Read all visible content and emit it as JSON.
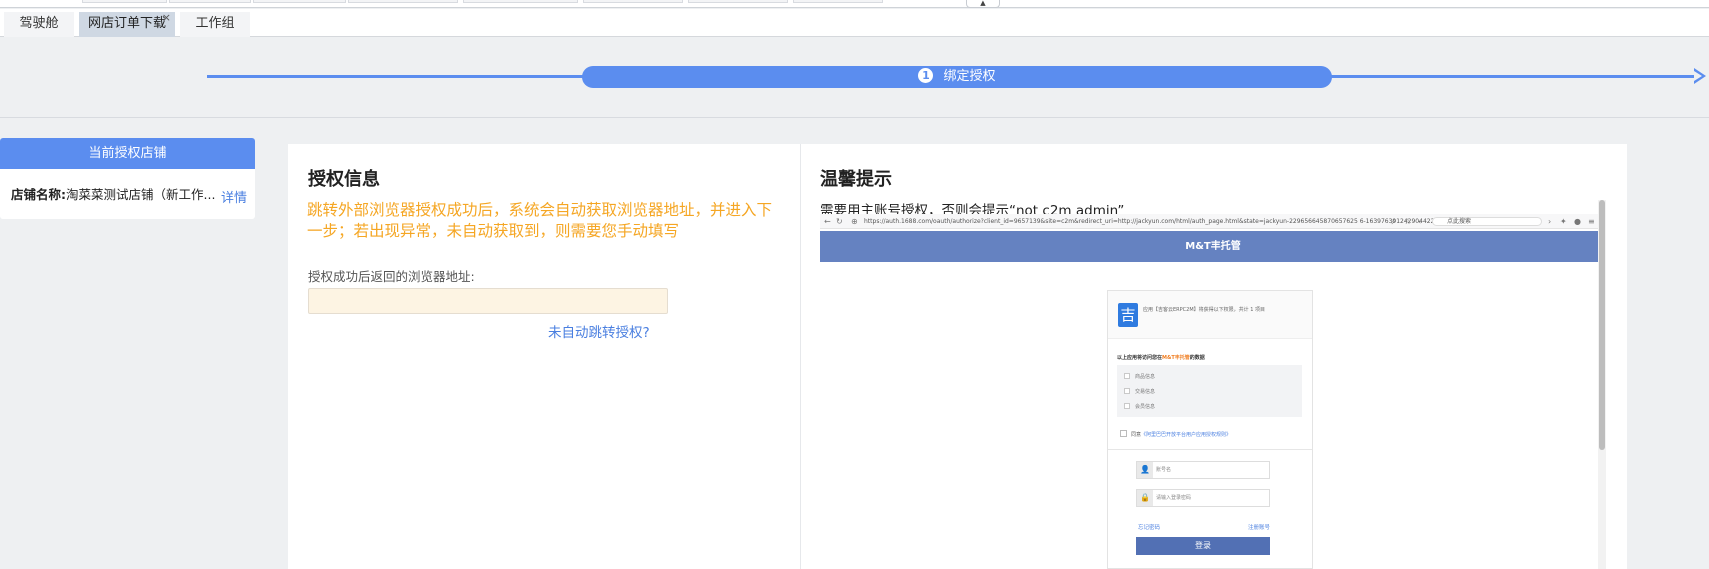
{
  "tabs": [
    {
      "label": "驾驶舱",
      "active": false
    },
    {
      "label": "网店订单下载",
      "active": true,
      "close": "×"
    },
    {
      "label": "工作组",
      "active": false
    }
  ],
  "collapse_glyph": "▲",
  "step": {
    "number": "1",
    "label": "绑定授权"
  },
  "left_card": {
    "header": "当前授权店铺",
    "shop_label": "店铺名称:",
    "shop_name": "淘菜菜测试店铺（新工作...",
    "detail_link": "详情"
  },
  "auth_info": {
    "title": "授权信息",
    "warning": "跳转外部浏览器授权成功后，系统会自动获取浏览器地址，并进入下一步；若出现异常，未自动获取到，则需要您手动填写",
    "field_label": "授权成功后返回的浏览器地址:",
    "field_value": "",
    "no_redirect_link": "未自动跳转授权?"
  },
  "tips": {
    "title": "温馨提示",
    "hint": "需要用主账号授权，否则会提示“not c2m admin”"
  },
  "embedded": {
    "url": "https://auth.1688.com/oauth/authorize?client_id=9657139&site=c2m&redirect_uri=http://jackyun.com/html/auth_page.html&state=jackyun-229656645870657625 6-1639763912429044224-02",
    "search_placeholder": "点此搜索",
    "banner": "M&T丰托管",
    "app_text": "应用【吉客云ERPC2M】将获得以下权限，共计 1 项目",
    "perm_prefix": "以上应用将访问您在",
    "perm_brand": "M&T丰托管",
    "perm_suffix": "的数据",
    "permissions": [
      "商品信息",
      "交易信息",
      "会员信息"
    ],
    "agree_prefix": "同意",
    "agree_link": "《阿里巴巴开放平台用户应用授权规则》",
    "account_placeholder": "账号名",
    "password_placeholder": "请输入登录密码",
    "forgot": "忘记密码",
    "register": "注册账号",
    "login_button": "登录",
    "logo_char": "吉"
  },
  "colors": {
    "accent": "#5b8def",
    "warning": "#f5a623",
    "link": "#4a7fe0",
    "banner": "#6582c1"
  }
}
